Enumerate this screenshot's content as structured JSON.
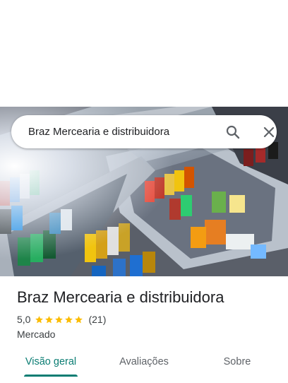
{
  "search": {
    "query": "Braz Mercearia e distribuidora",
    "search_icon": "search-icon",
    "clear_icon": "close-icon"
  },
  "place": {
    "name": "Braz Mercearia e distribuidora",
    "rating": "5,0",
    "stars": 5,
    "review_count": "(21)",
    "category": "Mercado"
  },
  "tabs": [
    {
      "label": "Visão geral",
      "active": true
    },
    {
      "label": "Avaliações",
      "active": false
    },
    {
      "label": "Sobre",
      "active": false
    }
  ],
  "colors": {
    "accent": "#0b7d73",
    "star": "#fbbc04"
  }
}
